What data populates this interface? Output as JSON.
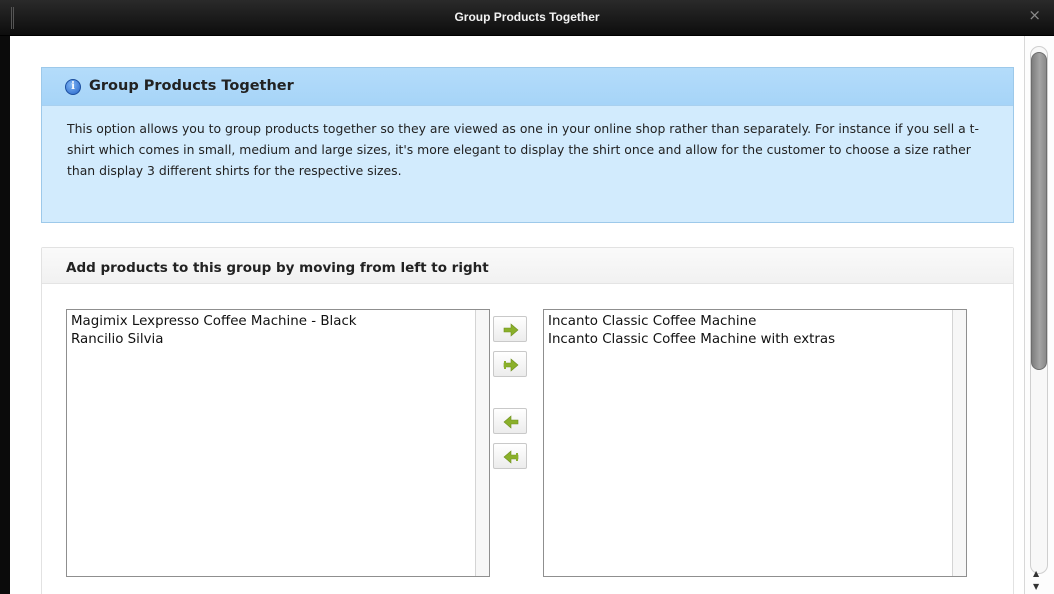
{
  "window": {
    "title": "Group Products Together",
    "close_glyph": "×"
  },
  "info": {
    "icon": "info-icon",
    "title": "Group Products Together",
    "body": "This option allows you to group products together so they are viewed as one in your online shop rather than separately. For instance if you sell a t-shirt which comes in small, medium and large sizes, it's more elegant to display the shirt once and allow for the customer to choose a size rather than display 3 different shirts for the respective sizes."
  },
  "group": {
    "title": "Add products to this group by moving from left to right",
    "available": [
      "Magimix Lexpresso Coffee Machine - Black",
      "Rancilio Silvia"
    ],
    "selected": [
      "Incanto Classic Coffee Machine",
      "Incanto Classic Coffee Machine with extras"
    ],
    "buttons": [
      {
        "icon": "arrow-right-icon"
      },
      {
        "icon": "double-arrow-right-icon"
      },
      {
        "icon": "arrow-left-icon"
      },
      {
        "icon": "double-arrow-left-icon"
      }
    ]
  },
  "colors": {
    "info_bg": "#d2ebfd",
    "info_header": "#a6d4f8",
    "arrow_green": "#8ab02a",
    "titlebar": "#111111"
  }
}
